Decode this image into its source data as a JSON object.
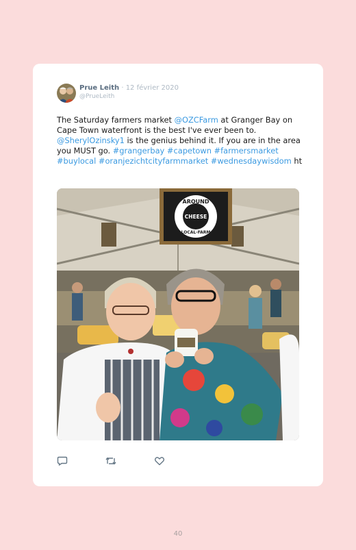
{
  "tweet": {
    "author_name": "Prue Leith",
    "separator": "·",
    "date": "12 février 2020",
    "handle": "@PrueLeith",
    "text_1": "The Saturday farmers market ",
    "mention_1": "@OZCFarm",
    "text_2": " at Granger Bay on Cape Town waterfront is the best I've ever been to. ",
    "mention_2": "@SherylOzinsky1",
    "text_3": " is the genius behind it. If you are in the area you MUST go. ",
    "hashtags": "#grangerbay #capetown #farmersmarket #buylocal #oranjezichtcityfarmmarket #wednesdaywisdom",
    "text_4": " ht",
    "sign": {
      "top": "AROUND",
      "middle": "CHEESE",
      "bottom": "LOCAL-FARM"
    },
    "actions": {
      "reply_icon": "reply-icon",
      "retweet_icon": "retweet-icon",
      "like_icon": "heart-icon"
    }
  },
  "page_number": "40",
  "colors": {
    "page_background": "#fbdcdc",
    "link": "#3b9ae1",
    "name": "#5a6d80"
  }
}
